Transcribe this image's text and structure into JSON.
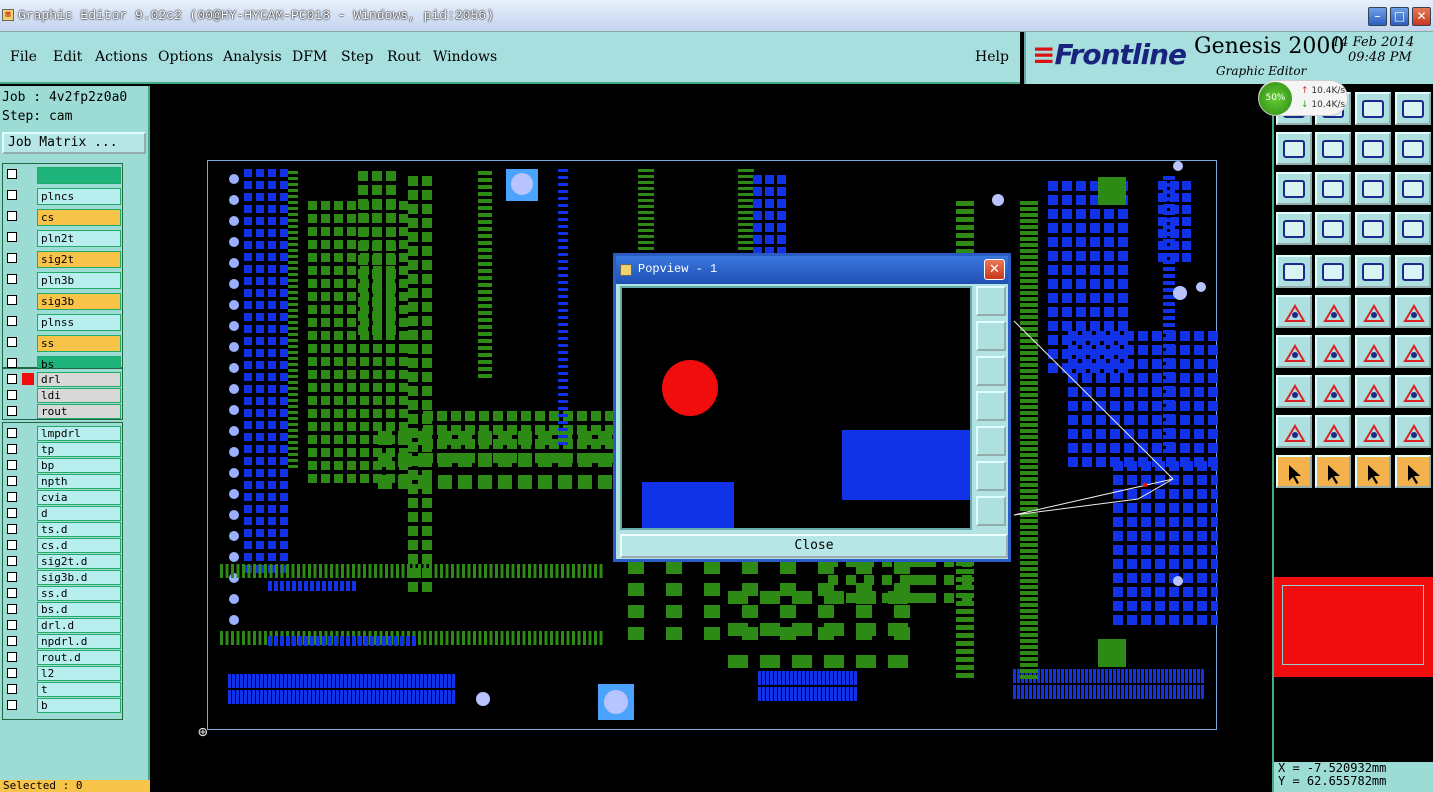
{
  "window": {
    "title": "Graphic Editor 9.02c2 (00@HY-HYCAM-PC018 - Windows, pid:2056)",
    "minimize": "–",
    "maximize": "□",
    "close": "✕"
  },
  "menu": {
    "items": [
      {
        "label": "File"
      },
      {
        "label": "Edit"
      },
      {
        "label": "Actions"
      },
      {
        "label": "Options"
      },
      {
        "label": "Analysis"
      },
      {
        "label": "DFM"
      },
      {
        "label": "Step"
      },
      {
        "label": "Rout"
      },
      {
        "label": "Windows"
      }
    ],
    "help": "Help"
  },
  "brand": {
    "logo": "Frontline",
    "product": "Genesis 2000",
    "subtitle": "Graphic Editor",
    "date": "14 Feb 2014",
    "time": "09:48 PM"
  },
  "job": {
    "job_line": "Job : 4v2fp2z0a0",
    "step_line": "Step: cam",
    "matrix_button": "Job Matrix ..."
  },
  "layers_board": [
    {
      "name": "",
      "color": "#1db37a"
    },
    {
      "name": "plncs",
      "color": "#b8eeee"
    },
    {
      "name": "cs",
      "color": "#f7c349"
    },
    {
      "name": "pln2t",
      "color": "#b8eeee"
    },
    {
      "name": "sig2t",
      "color": "#f7c349"
    },
    {
      "name": "pln3b",
      "color": "#b8eeee"
    },
    {
      "name": "sig3b",
      "color": "#f7c349"
    },
    {
      "name": "plnss",
      "color": "#b8eeee"
    },
    {
      "name": "ss",
      "color": "#f7c349"
    },
    {
      "name": "bs",
      "color": "#1db37a"
    }
  ],
  "layers_drill": [
    {
      "name": "drl",
      "color": "#d8d8d8"
    },
    {
      "name": "ldi",
      "color": "#d8d8d8"
    },
    {
      "name": "rout",
      "color": "#d8d8d8"
    }
  ],
  "layers_misc": [
    {
      "name": "lmpdrl"
    },
    {
      "name": "tp"
    },
    {
      "name": "bp"
    },
    {
      "name": "npth"
    },
    {
      "name": "cvia"
    },
    {
      "name": "d"
    },
    {
      "name": "ts.d"
    },
    {
      "name": "cs.d"
    },
    {
      "name": "sig2t.d"
    },
    {
      "name": "sig3b.d"
    },
    {
      "name": "ss.d"
    },
    {
      "name": "bs.d"
    },
    {
      "name": "drl.d"
    },
    {
      "name": "npdrl.d"
    },
    {
      "name": "rout.d"
    },
    {
      "name": "l2"
    },
    {
      "name": "t"
    },
    {
      "name": "b"
    }
  ],
  "status": {
    "selected": "Selected : 0"
  },
  "net": {
    "percent": "50%",
    "up": "10.4K/s",
    "down": "10.4K/s"
  },
  "coords": {
    "x": "X = -7.520932mm",
    "y": "Y = 62.655782mm"
  },
  "popview": {
    "title": "Popview - 1",
    "close_label": "Close"
  },
  "colors": {
    "pad_blue": "#1232e8",
    "pad_green": "#2d8a14",
    "panel": "#9cdcd4",
    "highlight_red": "#f10d0d"
  }
}
